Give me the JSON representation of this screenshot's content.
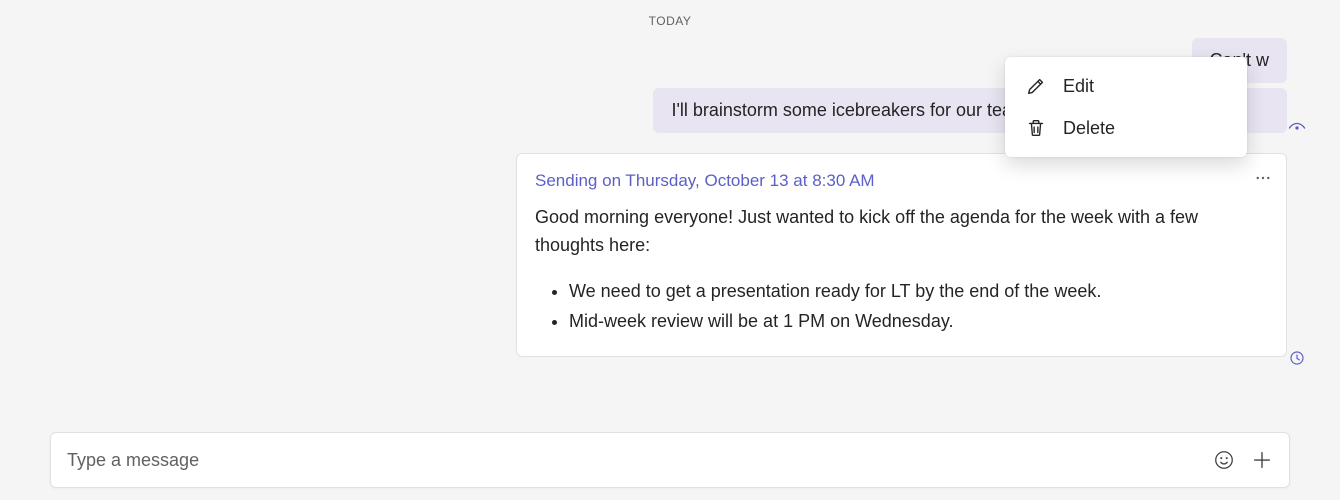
{
  "divider": {
    "label": "TODAY"
  },
  "sent_messages": [
    {
      "text": "Can't w"
    },
    {
      "text": "I'll brainstorm some icebreakers for our team"
    }
  ],
  "scheduled": {
    "status": "Sending on Thursday, October 13 at 8:30 AM",
    "intro": "Good morning everyone! Just wanted to kick off the agenda for the week with a few thoughts here:",
    "bullets": [
      "We need to get a presentation ready for LT by the end of the week.",
      "Mid-week review will be at 1 PM on Wednesday."
    ]
  },
  "context_menu": {
    "edit": "Edit",
    "delete": "Delete"
  },
  "compose": {
    "placeholder": "Type a message"
  },
  "icons": {
    "edit": "edit-icon",
    "delete": "delete-icon",
    "more": "more-icon",
    "eye": "read-receipt-icon",
    "clock": "scheduled-clock-icon",
    "emoji": "emoji-icon",
    "plus": "plus-icon"
  }
}
